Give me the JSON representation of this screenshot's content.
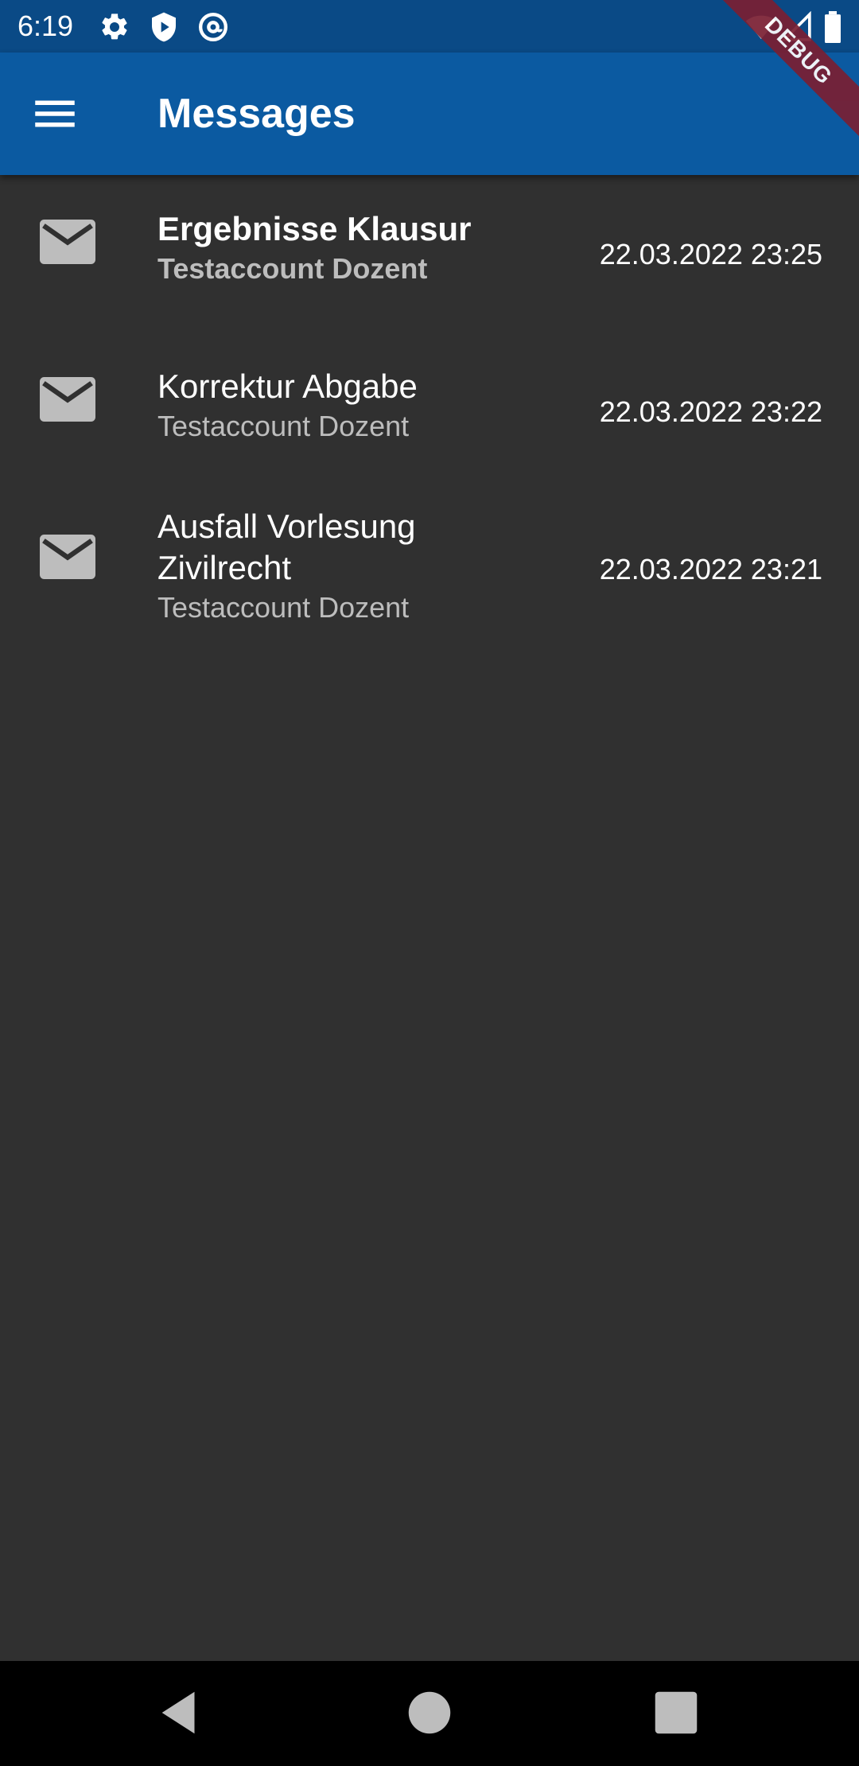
{
  "status_bar": {
    "time": "6:19",
    "icons": [
      "settings-icon",
      "shield-play-icon",
      "at-sign-icon",
      "wifi-icon",
      "signal-icon",
      "battery-icon"
    ]
  },
  "app_bar": {
    "title": "Messages",
    "menu_icon": "menu-icon",
    "debug_label": "DEBUG"
  },
  "colors": {
    "status_bar": "#0a4a86",
    "app_bar": "#0b5aa1",
    "background": "#303030",
    "icon_grey": "#bdbdbd",
    "debug_banner": "#7a1f33"
  },
  "messages": [
    {
      "title": "Ergebnisse Klausur",
      "sender": "Testaccount Dozent",
      "date": "22.03.2022 23:25",
      "unread": true,
      "icon": "mail-icon"
    },
    {
      "title": "Korrektur Abgabe",
      "sender": "Testaccount Dozent",
      "date": "22.03.2022 23:22",
      "unread": false,
      "icon": "mail-icon"
    },
    {
      "title": "Ausfall Vorlesung Zivilrecht",
      "sender": "Testaccount Dozent",
      "date": "22.03.2022 23:21",
      "unread": false,
      "icon": "mail-icon"
    }
  ],
  "nav_bar": {
    "icons": [
      "back-icon",
      "home-icon",
      "recents-icon"
    ]
  }
}
